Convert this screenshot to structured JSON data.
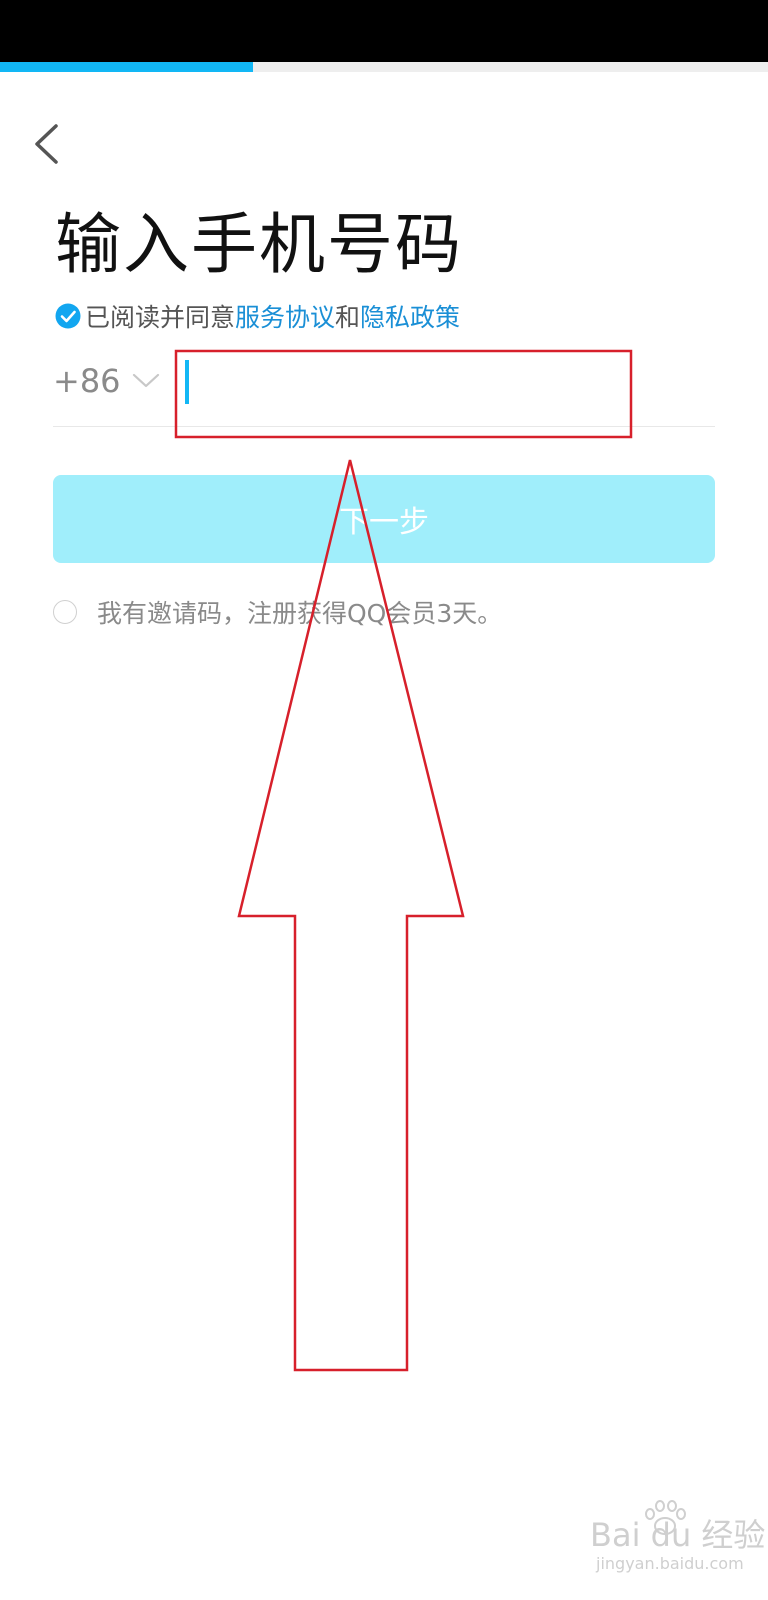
{
  "progress": {
    "value": 0.33,
    "color": "#12b7f5"
  },
  "header": {
    "back_icon": "chevron-left-icon"
  },
  "title": "输入手机号码",
  "agreement": {
    "checked": true,
    "prefix": "已阅读并同意",
    "terms_link": "服务协议",
    "and": "和",
    "privacy_link": "隐私政策",
    "link_color": "#1a8fd6"
  },
  "phone": {
    "country_code": "+86",
    "value": "",
    "placeholder": ""
  },
  "next_button": {
    "label": "下一步",
    "background": "#a0eefb",
    "text_color": "#ffffff",
    "disabled": true
  },
  "invite": {
    "checked": false,
    "label": "我有邀请码，注册获得QQ会员3天。"
  },
  "annotation": {
    "color": "#d7202b"
  },
  "watermark": {
    "brand": "Bai du 经验",
    "url": "jingyan.baidu.com"
  }
}
